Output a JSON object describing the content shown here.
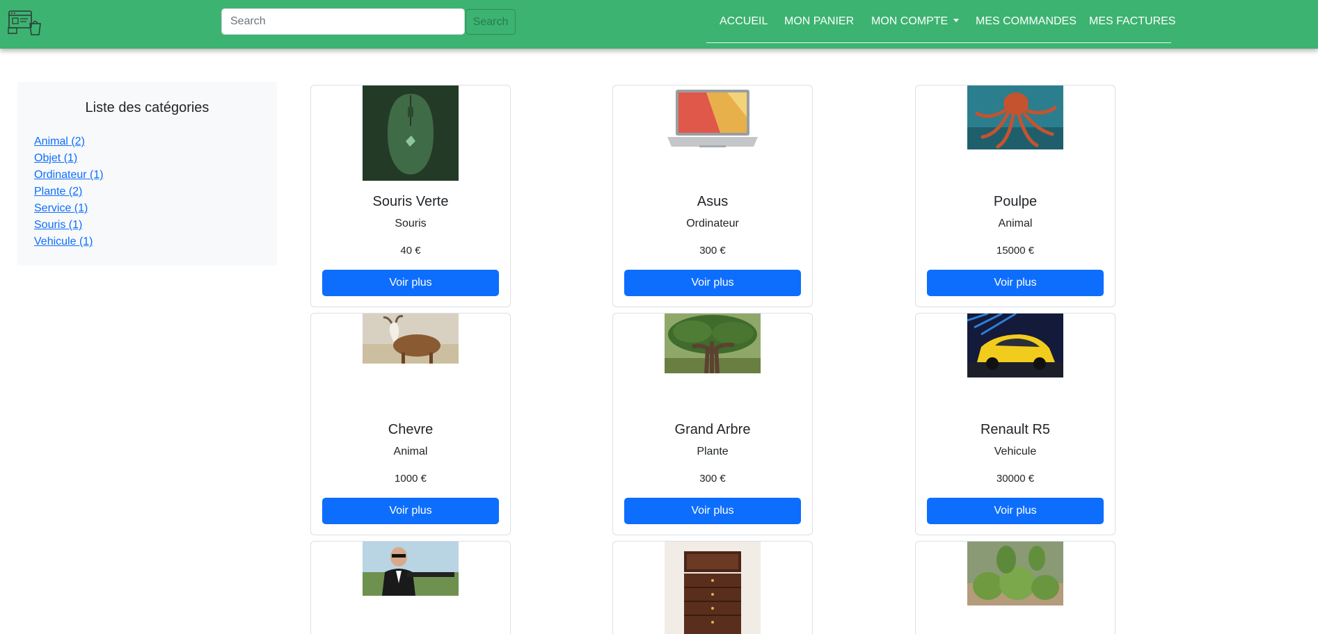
{
  "navbar": {
    "logo_icon": "shop-logo-icon",
    "search_placeholder": "Search",
    "search_button": "Search",
    "links": [
      "ACCUEIL",
      "MON PANIER",
      "MON COMPTE",
      "MES COMMANDES",
      "MES FACTURES"
    ]
  },
  "sidebar": {
    "title": "Liste des catégories",
    "categories": [
      "Animal (2)",
      "Objet (1)",
      "Ordinateur (1)",
      "Plante (2)",
      "Service (1)",
      "Souris (1)",
      "Vehicule (1)"
    ]
  },
  "products": [
    {
      "name": "Souris Verte",
      "category": "Souris",
      "price": "40 €",
      "button": "Voir plus",
      "image": "green-gaming-mouse"
    },
    {
      "name": "Asus",
      "category": "Ordinateur",
      "price": "300 €",
      "button": "Voir plus",
      "image": "laptop"
    },
    {
      "name": "Poulpe",
      "category": "Animal",
      "price": "15000 €",
      "button": "Voir plus",
      "image": "octopus"
    },
    {
      "name": "Chevre",
      "category": "Animal",
      "price": "1000 €",
      "button": "Voir plus",
      "image": "goat"
    },
    {
      "name": "Grand Arbre",
      "category": "Plante",
      "price": "300 €",
      "button": "Voir plus",
      "image": "large-tree"
    },
    {
      "name": "Renault R5",
      "category": "Vehicule",
      "price": "30000 €",
      "button": "Voir plus",
      "image": "yellow-car"
    },
    {
      "image": "agent-with-gun"
    },
    {
      "image": "jewelry-box"
    },
    {
      "image": "cactus"
    }
  ],
  "colors": {
    "navbar": "#3cb371",
    "primary": "#0d6efd",
    "sidebar_bg": "#f8f9fa"
  }
}
